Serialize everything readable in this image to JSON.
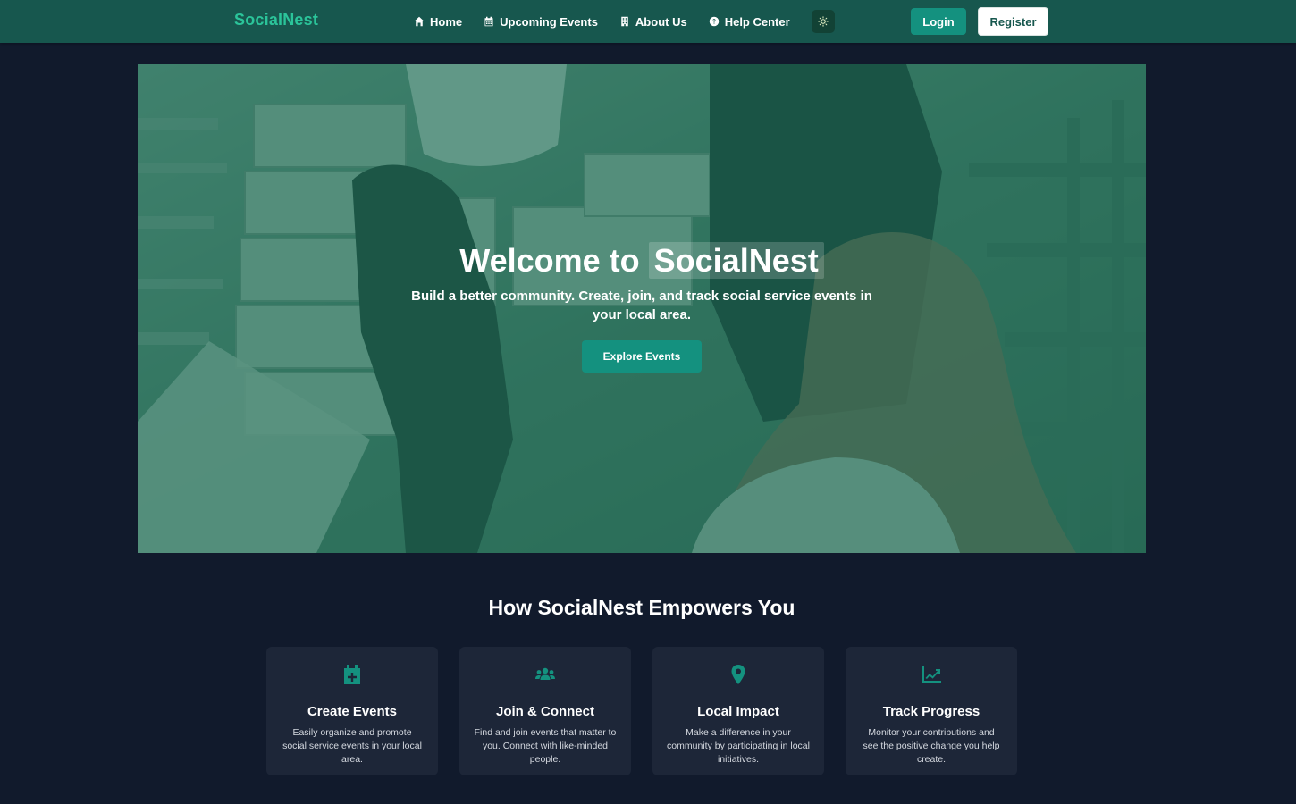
{
  "brand": {
    "name": "SocialNest",
    "color": "#2bc49a"
  },
  "nav": {
    "items": [
      {
        "label": "Home",
        "icon": "home-icon"
      },
      {
        "label": "Upcoming Events",
        "icon": "calendar-icon"
      },
      {
        "label": "About Us",
        "icon": "building-icon"
      },
      {
        "label": "Help Center",
        "icon": "question-circle-icon"
      }
    ],
    "theme_toggle_icon": "sun-icon",
    "login_label": "Login",
    "register_label": "Register"
  },
  "hero": {
    "title_prefix": "Welcome to",
    "title_highlight": "SocialNest",
    "subtitle": "Build a better community. Create, join, and track social service events in your local area.",
    "cta_label": "Explore Events"
  },
  "features": {
    "title": "How SocialNest Empowers You",
    "cards": [
      {
        "icon": "calendar-plus-icon",
        "title": "Create Events",
        "description": "Easily organize and promote social service events in your local area."
      },
      {
        "icon": "users-icon",
        "title": "Join & Connect",
        "description": "Find and join events that matter to you. Connect with like-minded people."
      },
      {
        "icon": "map-pin-icon",
        "title": "Local Impact",
        "description": "Make a difference in your community by participating in local initiatives."
      },
      {
        "icon": "chart-line-icon",
        "title": "Track Progress",
        "description": "Monitor your contributions and see the positive change you help create."
      }
    ]
  },
  "colors": {
    "navbar": "#17574e",
    "accent": "#14917f",
    "background": "#111a2c",
    "card": "#1d2638"
  }
}
